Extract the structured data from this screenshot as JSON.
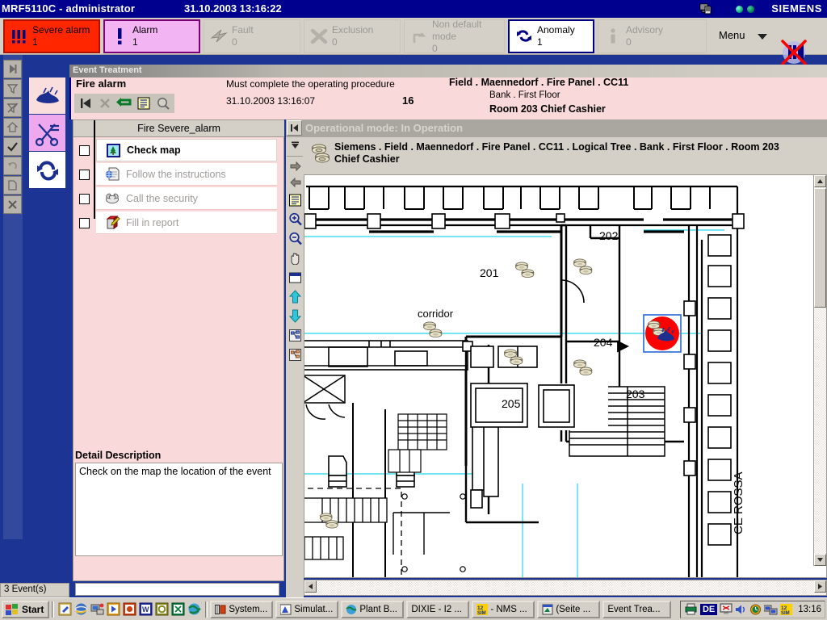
{
  "window": {
    "app_title": "MRF5110C - administrator",
    "datetime": "31.10.2003 13:16:22",
    "brand": "SIEMENS"
  },
  "alarm_strip": {
    "buttons": [
      {
        "name": "severe-alarm",
        "label": "Severe alarm",
        "count": "1",
        "state": "active",
        "icon": "triple-exclamation-icon"
      },
      {
        "name": "alarm",
        "label": "Alarm",
        "count": "1",
        "state": "active",
        "icon": "exclamation-icon"
      },
      {
        "name": "fault",
        "label": "Fault",
        "count": "0",
        "state": "inactive",
        "icon": "lightning-icon"
      },
      {
        "name": "exclusion",
        "label": "Exclusion",
        "count": "0",
        "state": "inactive",
        "icon": "x-cross-icon"
      },
      {
        "name": "non-default-mode",
        "label": "Non default mode",
        "count": "0",
        "state": "inactive",
        "icon": "arrow-branch-icon"
      },
      {
        "name": "anomaly",
        "label": "Anomaly",
        "count": "1",
        "state": "active",
        "icon": "circular-arrows-icon"
      },
      {
        "name": "advisory",
        "label": "Advisory",
        "count": "0",
        "state": "inactive",
        "icon": "info-icon"
      }
    ],
    "menu_label": "Menu",
    "silence_button_name": "silence-buzzer-button"
  },
  "event_treatment": {
    "window_title": "Event Treatment",
    "event_type": "Fire alarm",
    "instruction": "Must complete the operating procedure",
    "event_datetime": "31.10.2003  13:16:07",
    "event_number": "16",
    "location_line1": "Field . Maennedorf . Fire Panel . CC11",
    "location_line2": "Bank . First Floor",
    "location_line3": "Room 203  Chief Cashier",
    "toolbar": [
      {
        "name": "first-event-button",
        "icon": "skip-previous-icon"
      },
      {
        "name": "close-event-button",
        "icon": "x-cross-icon"
      },
      {
        "name": "back-button",
        "icon": "return-arrow-icon"
      },
      {
        "name": "event-list-button",
        "icon": "document-list-icon"
      },
      {
        "name": "inspect-button",
        "icon": "magnifier-icon"
      }
    ],
    "task_panel": {
      "header": "Fire Severe_alarm",
      "tasks": [
        {
          "label": "Check map",
          "icon": "map-tree-icon",
          "checked": false,
          "active": true
        },
        {
          "label": "Follow the instructions",
          "icon": "instructions-page-icon",
          "checked": false,
          "active": false
        },
        {
          "label": "Call the security",
          "icon": "telephone-icon",
          "checked": false,
          "active": false
        },
        {
          "label": "Fill in report",
          "icon": "report-pen-icon",
          "checked": false,
          "active": false
        }
      ],
      "detail_title": "Detail Description",
      "detail_text": "Check on the map the location of the event"
    }
  },
  "map_window": {
    "operational_mode": "Operational mode: In Operation",
    "collapse_button_name": "collapse-panel-button",
    "path_line1": "Siemens . Field . Maennedorf . Fire Panel . CC11 . Logical Tree . Bank . First Floor . Room 203",
    "path_line2": "Chief Cashier",
    "tools": [
      {
        "name": "dropdown-tool",
        "icon": "chevron-down-icon"
      },
      {
        "name": "forward-tool",
        "icon": "arrow-right-icon"
      },
      {
        "name": "back-tool",
        "icon": "arrow-left-icon"
      },
      {
        "name": "notes-tool",
        "icon": "document-list-icon"
      },
      {
        "name": "zoom-in-tool",
        "icon": "magnifier-plus-icon"
      },
      {
        "name": "zoom-out-tool",
        "icon": "magnifier-minus-icon"
      },
      {
        "name": "pan-tool",
        "icon": "hand-icon"
      },
      {
        "name": "window-tool",
        "icon": "window-icon"
      },
      {
        "name": "level-up-tool",
        "icon": "arrow-up-icon"
      },
      {
        "name": "level-down-tool",
        "icon": "arrow-down-icon"
      },
      {
        "name": "tree-view-tool",
        "icon": "tree-view-icon"
      },
      {
        "name": "tree-view-tool-2",
        "icon": "tree-view-icon"
      }
    ],
    "floorplan": {
      "room_labels": [
        "201",
        "202",
        "203",
        "204",
        "205",
        "corridor"
      ],
      "vertical_label": "CE ROSSA",
      "alarm_marker": {
        "name": "fire-alarm-marker",
        "fill_color": "#ff0000",
        "selection_color": "#3c78d8",
        "icon": "fire-flame-icon"
      },
      "detector_icon_name": "smoke-detector-icon",
      "detector_count": 6
    }
  },
  "status_bar": {
    "event_count": "3 Event(s)"
  },
  "taskbar": {
    "start_label": "Start",
    "quick_launch": [
      {
        "name": "notepad-icon"
      },
      {
        "name": "internet-explorer-icon"
      },
      {
        "name": "network-icon"
      },
      {
        "name": "media-player-icon"
      },
      {
        "name": "powerpoint-icon"
      },
      {
        "name": "word-icon"
      },
      {
        "name": "outlook-icon"
      },
      {
        "name": "excel-icon"
      },
      {
        "name": "globe-icon"
      }
    ],
    "tasks": [
      {
        "label": "System...",
        "icon": "system-icon"
      },
      {
        "label": "Simulat...",
        "icon": "simulator-icon"
      },
      {
        "label": "Plant B...",
        "icon": "globe-icon"
      },
      {
        "label": "DIXIE - I2 ...",
        "icon": "none"
      },
      {
        "label": "- NMS ...",
        "icon": "sim-icon"
      },
      {
        "label": "(Seite ...",
        "icon": "window-icon"
      },
      {
        "label": "Event Trea...",
        "icon": "none"
      }
    ],
    "tray": {
      "language": "DE",
      "time": "13:16",
      "icons": [
        "printer-icon",
        "monitor-icon",
        "volume-icon",
        "clock-icon",
        "network-icon",
        "sim-icon"
      ]
    }
  }
}
